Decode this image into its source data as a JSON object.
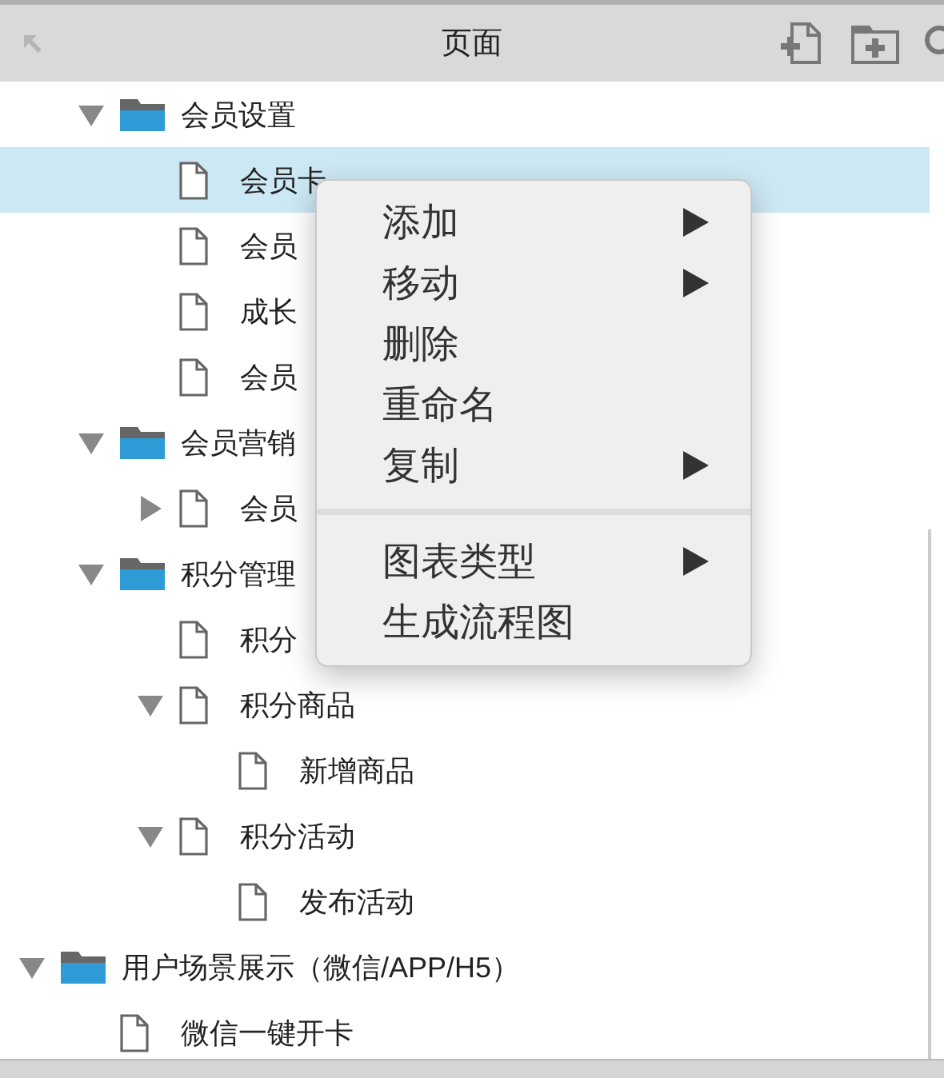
{
  "panel": {
    "title": "页面",
    "back_disabled": true
  },
  "tree": [
    {
      "children": [
        {
          "label": "会员设置",
          "kind": "folder",
          "expanded": true,
          "selected": false,
          "children": [
            {
              "label": "会员卡",
              "kind": "page",
              "selected": true
            },
            {
              "label": "会员",
              "kind": "page",
              "selected": false
            },
            {
              "label": "成长",
              "kind": "page",
              "selected": false
            },
            {
              "label": "会员",
              "kind": "page",
              "selected": false
            }
          ]
        },
        {
          "label": "会员营销",
          "kind": "folder",
          "expanded": true,
          "selected": false,
          "children": [
            {
              "label": "会员",
              "kind": "page",
              "expanded": false,
              "selected": false
            }
          ]
        },
        {
          "label": "积分管理",
          "kind": "folder",
          "expanded": true,
          "selected": false,
          "children": [
            {
              "label": "积分",
              "kind": "page",
              "selected": false
            },
            {
              "label": "积分商品",
              "kind": "page",
              "expanded": true,
              "selected": false,
              "children": [
                {
                  "label": "新增商品",
                  "kind": "page",
                  "selected": false
                }
              ]
            },
            {
              "label": "积分活动",
              "kind": "page",
              "expanded": true,
              "selected": false,
              "children": [
                {
                  "label": "发布活动",
                  "kind": "page",
                  "selected": false
                }
              ]
            }
          ]
        }
      ]
    },
    {
      "label": "用户场景展示（微信/APP/H5）",
      "kind": "folder",
      "expanded": true,
      "selected": false,
      "children": [
        {
          "label": "微信一键开卡",
          "kind": "page",
          "selected": false
        }
      ]
    }
  ],
  "context_menu": {
    "groups": [
      [
        {
          "label": "添加",
          "submenu": true
        },
        {
          "label": "移动",
          "submenu": true
        },
        {
          "label": "删除",
          "submenu": false
        },
        {
          "label": "重命名",
          "submenu": false
        },
        {
          "label": "复制",
          "submenu": true
        }
      ],
      [
        {
          "label": "图表类型",
          "submenu": true
        },
        {
          "label": "生成流程图",
          "submenu": false
        }
      ]
    ]
  }
}
